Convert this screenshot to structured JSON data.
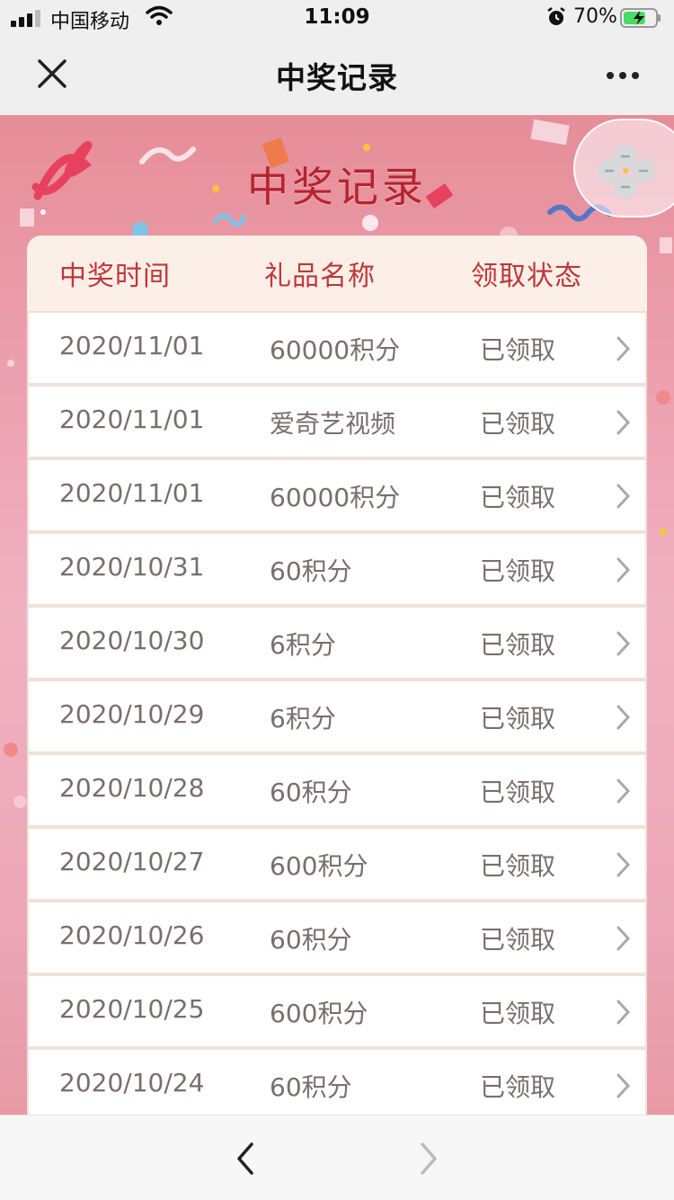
{
  "status_bar": {
    "carrier": "中国移动",
    "time": "11:09",
    "battery_percent": "70%",
    "battery_level": 0.7,
    "signal_bars": 3,
    "icons": [
      "signal-icon",
      "wifi-icon",
      "alarm-icon",
      "battery-charging-icon"
    ]
  },
  "nav": {
    "title": "中奖记录",
    "left_icon": "close-icon",
    "right_icon": "more-icon"
  },
  "banner": {
    "title": "中奖记录"
  },
  "floating_button": {
    "icon": "link-cluster-icon"
  },
  "table": {
    "headers": [
      "中奖时间",
      "礼品名称",
      "领取状态"
    ],
    "rows": [
      {
        "date": "2020/11/01",
        "gift": "60000积分",
        "status": "已领取"
      },
      {
        "date": "2020/11/01",
        "gift": "爱奇艺视频",
        "status": "已领取"
      },
      {
        "date": "2020/11/01",
        "gift": "60000积分",
        "status": "已领取"
      },
      {
        "date": "2020/10/31",
        "gift": "60积分",
        "status": "已领取"
      },
      {
        "date": "2020/10/30",
        "gift": "6积分",
        "status": "已领取"
      },
      {
        "date": "2020/10/29",
        "gift": "6积分",
        "status": "已领取"
      },
      {
        "date": "2020/10/28",
        "gift": "60积分",
        "status": "已领取"
      },
      {
        "date": "2020/10/27",
        "gift": "600积分",
        "status": "已领取"
      },
      {
        "date": "2020/10/26",
        "gift": "60积分",
        "status": "已领取"
      },
      {
        "date": "2020/10/25",
        "gift": "600积分",
        "status": "已领取"
      },
      {
        "date": "2020/10/24",
        "gift": "60积分",
        "status": "已领取"
      }
    ]
  },
  "toolbar": {
    "back_icon": "chevron-left-icon",
    "forward_icon": "chevron-right-icon",
    "forward_enabled": false
  },
  "colors": {
    "accent_red": "#c0373a",
    "title_red": "#b5232e",
    "cell_text": "#7a6d6d",
    "page_pink": "#ec9fae"
  }
}
